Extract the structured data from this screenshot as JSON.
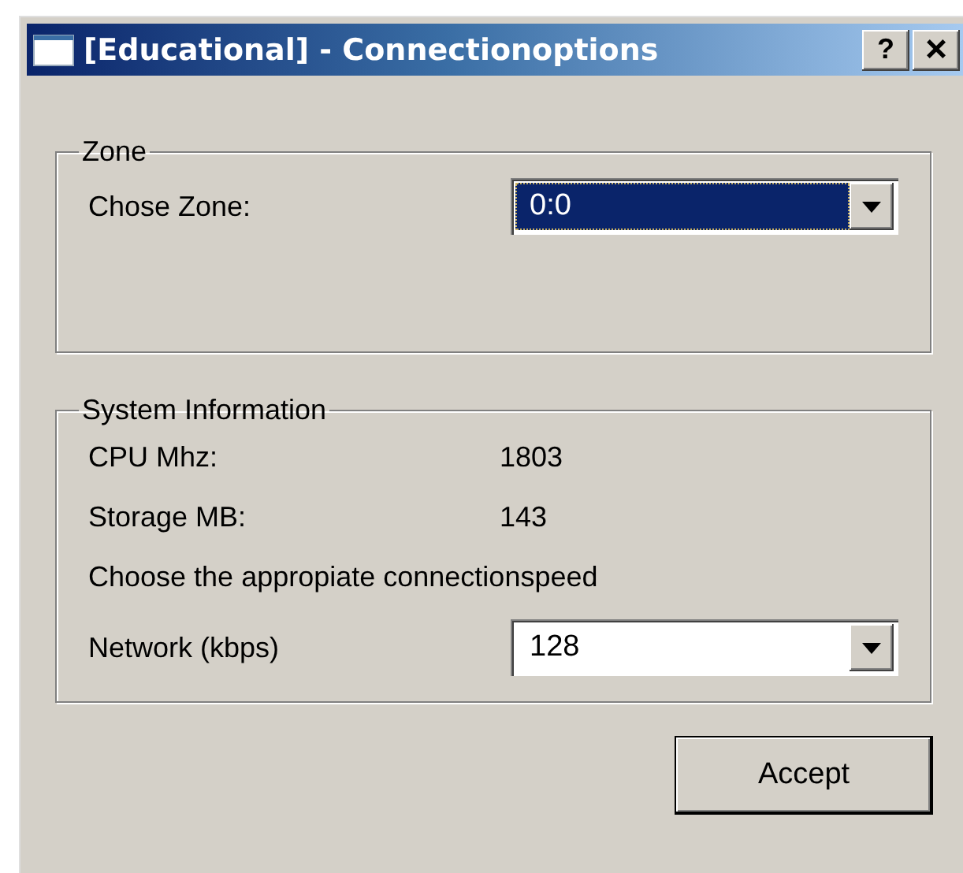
{
  "window": {
    "title": "[Educational] - Connectionoptions",
    "buttons": [
      {
        "kind": "help",
        "label": "?"
      },
      {
        "kind": "close",
        "label": "×"
      }
    ]
  },
  "zone_group": {
    "title": "Zone",
    "label": "Chose Zone:",
    "combo": {
      "value": "0:0",
      "focused": true
    }
  },
  "system_group": {
    "title": "System Information",
    "rows": [
      {
        "label": "CPU Mhz:",
        "value": "1803"
      },
      {
        "label": "Storage MB:",
        "value": "143"
      }
    ],
    "note": "Choose the appropiate connectionspeed",
    "network": {
      "label": "Network (kbps)",
      "combo": {
        "value": "128",
        "focused": false
      }
    }
  },
  "buttons": [
    "Accept"
  ]
}
